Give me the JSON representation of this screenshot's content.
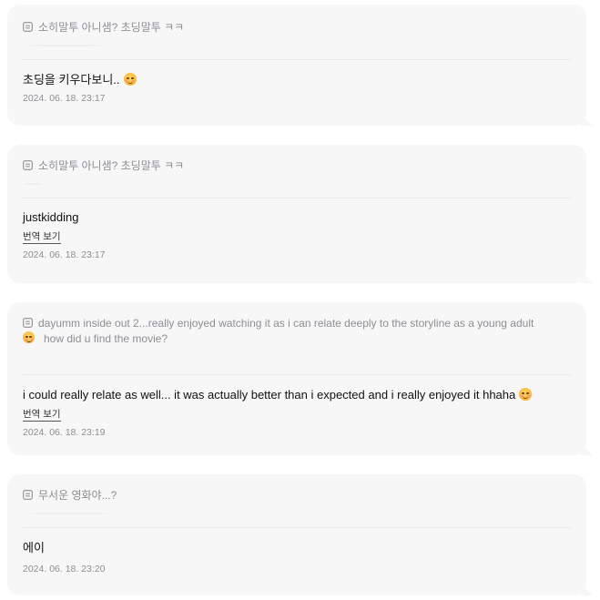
{
  "colors": {
    "card_background": "#f7f7f8",
    "muted_text": "#8e8e93",
    "primary_text": "#111111",
    "divider": "#e7e7ea"
  },
  "cards": [
    {
      "quote": "소히말투 아니샘? 초딩말투 ㅋㅋ",
      "message": "초딩을 키우다보니..",
      "message_emoji": "blushing-smile-emoji",
      "timestamp": "2024. 06. 18. 23:17"
    },
    {
      "quote": "소히말투 아니샘? 초딩말투 ㅋㅋ",
      "message": "justkidding",
      "translate_label": "번역 보기",
      "timestamp": "2024. 06. 18. 23:17"
    },
    {
      "quote": "dayumm inside out 2...really enjoyed watching it as i can relate deeply to the storyline as a young adult",
      "quote_line2": "how did u find the movie?",
      "quote_emoji": "hugging-face-emoji",
      "message": "i could really relate as well... it was actually better than i expected and i really enjoyed it hhaha",
      "message_emoji": "smiling-face-emoji",
      "translate_label": "번역 보기",
      "timestamp": "2024. 06. 18. 23:19"
    },
    {
      "quote": "무서운 영화야...?",
      "message": "에이",
      "timestamp": "2024. 06. 18. 23:20"
    }
  ]
}
